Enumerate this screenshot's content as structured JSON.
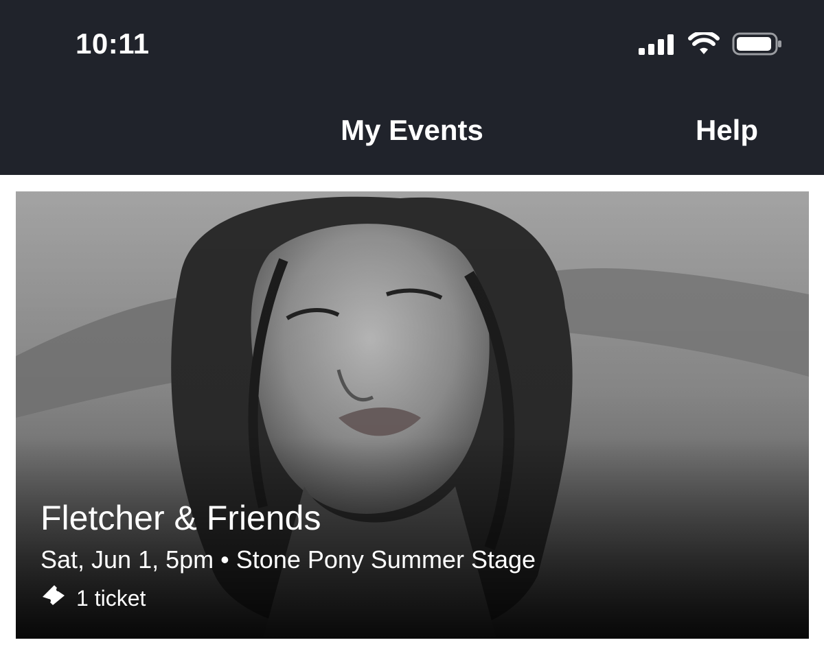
{
  "status_bar": {
    "time": "10:11",
    "icons": [
      "cellular-signal-icon",
      "wifi-icon",
      "battery-icon"
    ]
  },
  "nav": {
    "title": "My Events",
    "help_label": "Help"
  },
  "events": [
    {
      "title": "Fletcher & Friends",
      "date": "Sat, Jun 1, 5pm",
      "separator": "•",
      "venue": "Stone Pony Summer Stage",
      "tickets": "1 ticket",
      "ticket_icon": "ticket-icon",
      "image": "black-and-white portrait photo"
    }
  ],
  "colors": {
    "header_bg": "#20232b",
    "header_text": "#ffffff",
    "card_text": "#ffffff"
  }
}
